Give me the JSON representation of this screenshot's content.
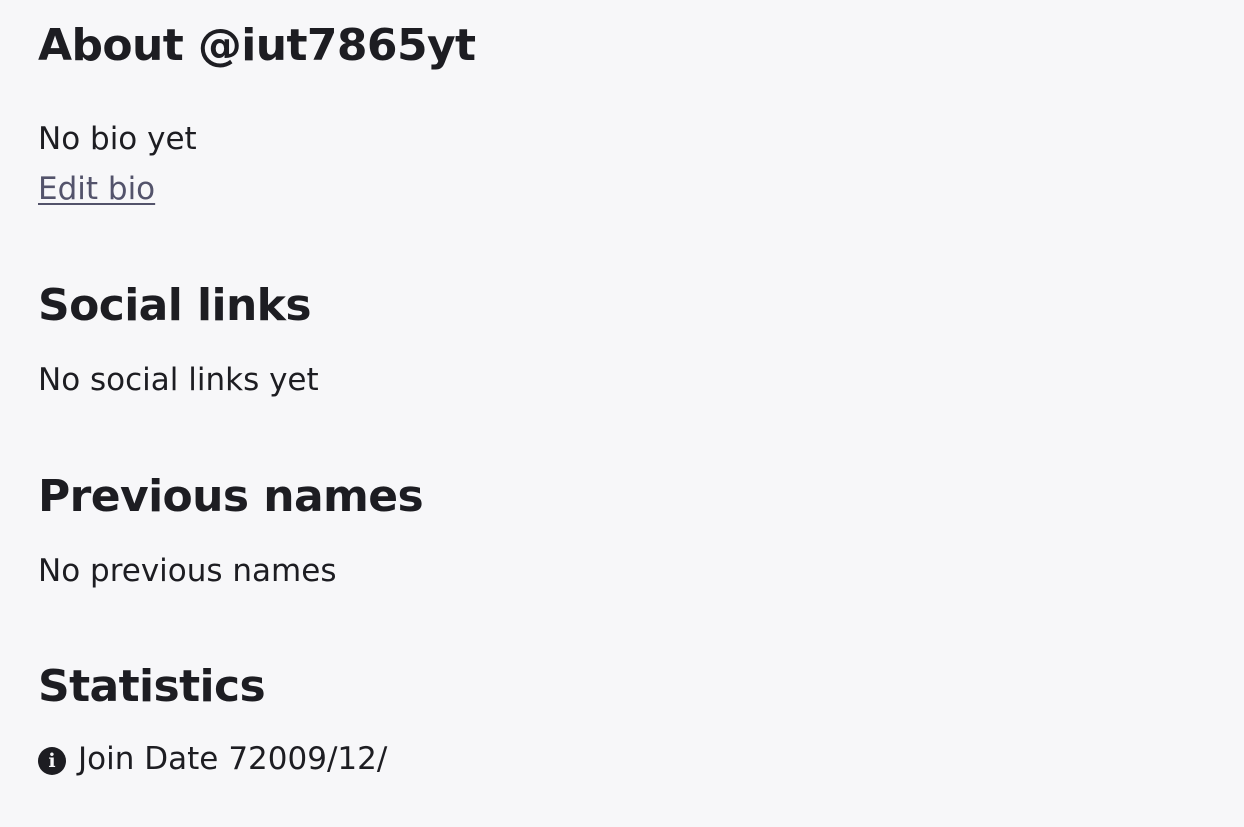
{
  "about": {
    "title": "About @iut7865yt",
    "bio": "No bio yet",
    "edit_bio_link": "Edit bio"
  },
  "social_links": {
    "title": "Social links",
    "empty_text": "No social links yet"
  },
  "previous_names": {
    "title": "Previous names",
    "empty_text": "No previous names"
  },
  "statistics": {
    "title": "Statistics",
    "icon": "info-icon",
    "join_date_label": "Join Date",
    "join_date_value": "72009/12/"
  }
}
